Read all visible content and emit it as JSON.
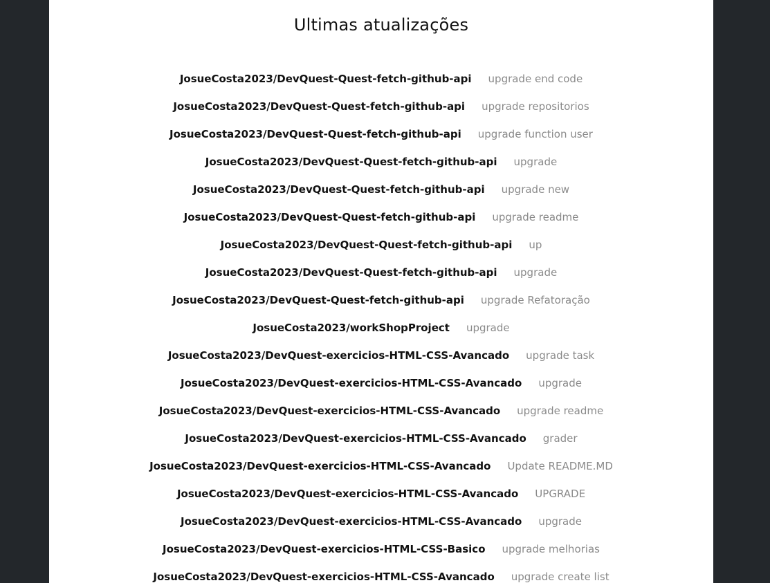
{
  "page": {
    "title": "Ultimas atualizações"
  },
  "events": [
    {
      "repo": "JosueCosta2023/DevQuest-Quest-fetch-github-api",
      "message": "upgrade end code"
    },
    {
      "repo": "JosueCosta2023/DevQuest-Quest-fetch-github-api",
      "message": "upgrade repositorios"
    },
    {
      "repo": "JosueCosta2023/DevQuest-Quest-fetch-github-api",
      "message": "upgrade function user"
    },
    {
      "repo": "JosueCosta2023/DevQuest-Quest-fetch-github-api",
      "message": "upgrade"
    },
    {
      "repo": "JosueCosta2023/DevQuest-Quest-fetch-github-api",
      "message": "upgrade new"
    },
    {
      "repo": "JosueCosta2023/DevQuest-Quest-fetch-github-api",
      "message": "upgrade readme"
    },
    {
      "repo": "JosueCosta2023/DevQuest-Quest-fetch-github-api",
      "message": "up"
    },
    {
      "repo": "JosueCosta2023/DevQuest-Quest-fetch-github-api",
      "message": "upgrade"
    },
    {
      "repo": "JosueCosta2023/DevQuest-Quest-fetch-github-api",
      "message": "upgrade Refatoração"
    },
    {
      "repo": "JosueCosta2023/workShopProject",
      "message": "upgrade"
    },
    {
      "repo": "JosueCosta2023/DevQuest-exercicios-HTML-CSS-Avancado",
      "message": "upgrade task"
    },
    {
      "repo": "JosueCosta2023/DevQuest-exercicios-HTML-CSS-Avancado",
      "message": "upgrade"
    },
    {
      "repo": "JosueCosta2023/DevQuest-exercicios-HTML-CSS-Avancado",
      "message": "upgrade readme"
    },
    {
      "repo": "JosueCosta2023/DevQuest-exercicios-HTML-CSS-Avancado",
      "message": "grader"
    },
    {
      "repo": "JosueCosta2023/DevQuest-exercicios-HTML-CSS-Avancado",
      "message": "Update README.MD"
    },
    {
      "repo": "JosueCosta2023/DevQuest-exercicios-HTML-CSS-Avancado",
      "message": "UPGRADE"
    },
    {
      "repo": "JosueCosta2023/DevQuest-exercicios-HTML-CSS-Avancado",
      "message": "upgrade"
    },
    {
      "repo": "JosueCosta2023/DevQuest-exercicios-HTML-CSS-Basico",
      "message": "upgrade melhorias"
    },
    {
      "repo": "JosueCosta2023/DevQuest-exercicios-HTML-CSS-Avancado",
      "message": "upgrade create list"
    }
  ]
}
